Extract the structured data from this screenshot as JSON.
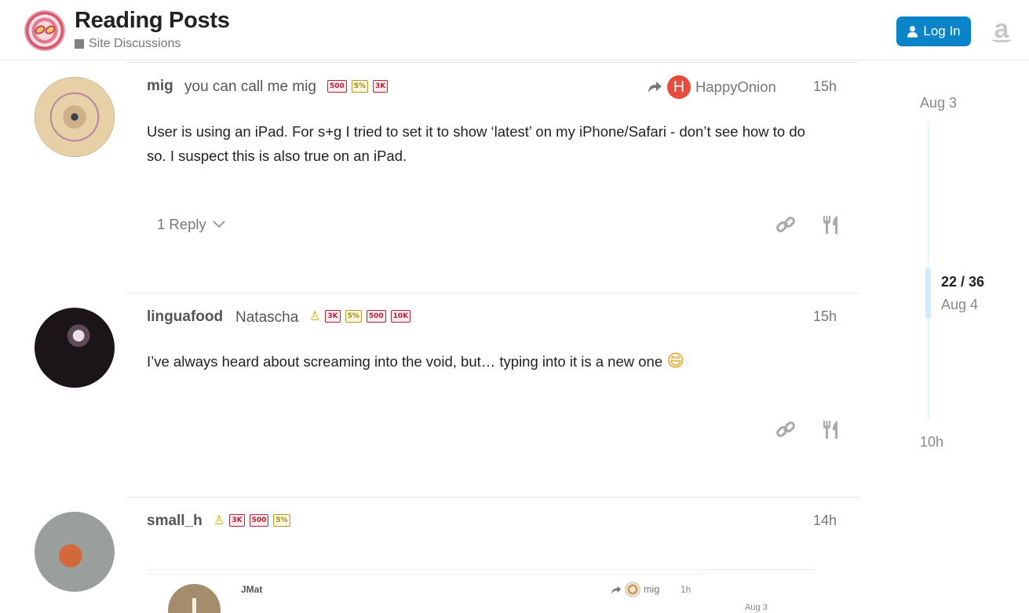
{
  "header": {
    "topic_title": "Reading Posts",
    "category": "Site Discussions",
    "login_label": "Log In"
  },
  "posts": [
    {
      "username": "mig",
      "fullname": "you can call me mig",
      "badges": [
        "500",
        "5%",
        "3K"
      ],
      "reply_to": "HappyOnion",
      "reply_to_initial": "H",
      "time": "15h",
      "body": "User is using an iPad. For s+g I tried to set it to show ‘latest’ on my iPhone/Safari - don’t see how to do so. I suspect this is also true on an iPad.",
      "replies": "1 Reply"
    },
    {
      "username": "linguafood",
      "fullname": "Natascha",
      "badges": [
        "3K",
        "5%",
        "500",
        "10K"
      ],
      "time": "15h",
      "body": "I’ve always heard about screaming into the void, but… typing into it is a new one",
      "emoji": "😄"
    },
    {
      "username": "small_h",
      "badges": [
        "3K",
        "500",
        "5%"
      ],
      "time": "14h",
      "quote": {
        "username": "JMat",
        "reply_to": "mig",
        "time": "1h",
        "date": "Aug 3"
      }
    }
  ],
  "timeline": {
    "start": "Aug 3",
    "position": "22 / 36",
    "position_date": "Aug 4",
    "end": "10h"
  }
}
